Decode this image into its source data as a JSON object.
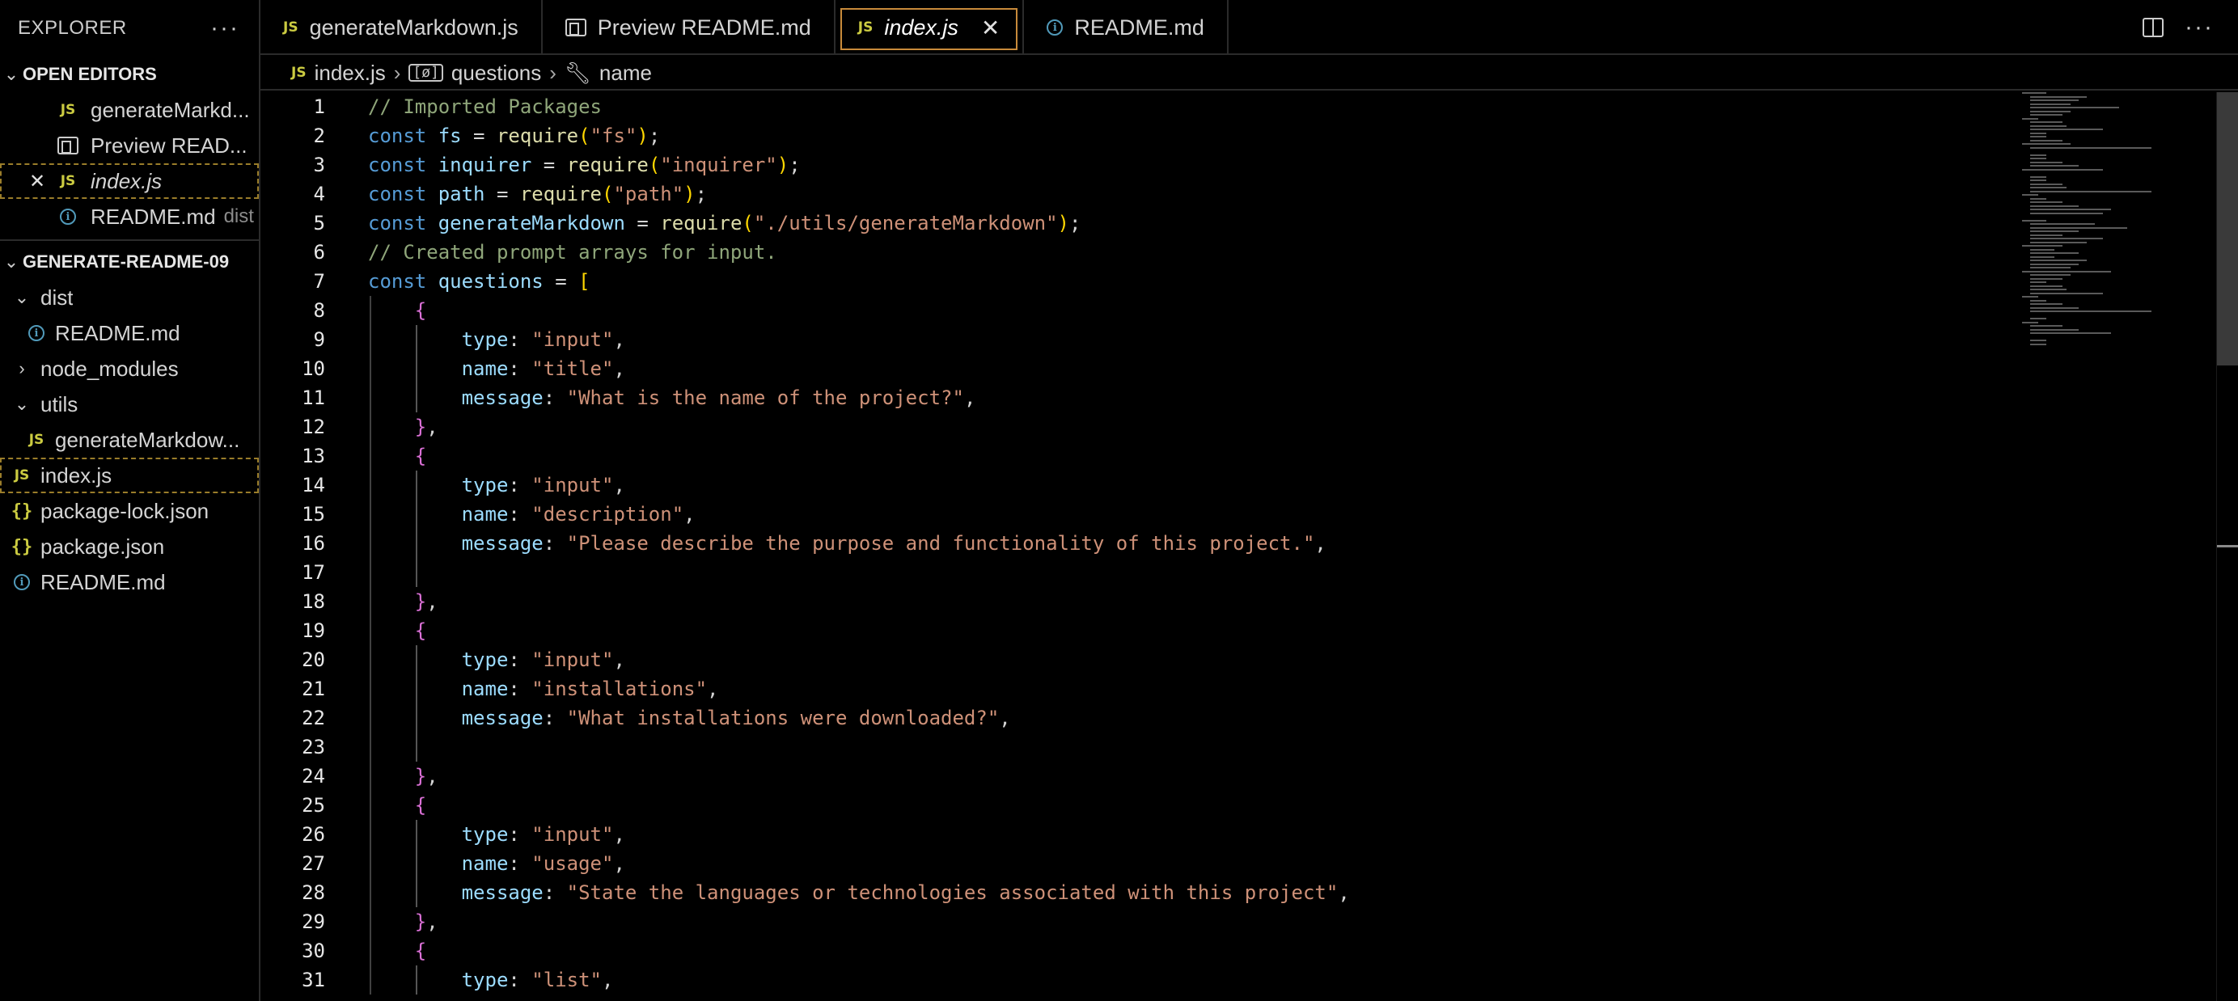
{
  "explorer": {
    "title": "EXPLORER",
    "more_label": "···",
    "open_editors_label": "OPEN EDITORS",
    "open_editors": [
      {
        "label": "generateMarkd...",
        "icon": "js-icon",
        "desc": ""
      },
      {
        "label": "Preview READ...",
        "icon": "preview-icon",
        "desc": ""
      },
      {
        "label": "index.js",
        "icon": "js-icon",
        "desc": "",
        "active": true
      },
      {
        "label": "README.md",
        "icon": "info-icon",
        "desc": "dist"
      }
    ],
    "project_label": "GENERATE-README-09",
    "tree": [
      {
        "label": "dist",
        "type": "folder-open"
      },
      {
        "label": "README.md",
        "type": "info"
      },
      {
        "label": "node_modules",
        "type": "folder-closed"
      },
      {
        "label": "utils",
        "type": "folder-open"
      },
      {
        "label": "generateMarkdow...",
        "type": "js"
      },
      {
        "label": "index.js",
        "type": "js"
      },
      {
        "label": "package-lock.json",
        "type": "json"
      },
      {
        "label": "package.json",
        "type": "json"
      },
      {
        "label": "README.md",
        "type": "info"
      }
    ]
  },
  "tabs": [
    {
      "label": "generateMarkdown.js",
      "icon": "js-icon"
    },
    {
      "label": "Preview README.md",
      "icon": "preview-icon"
    },
    {
      "label": "index.js",
      "icon": "js-icon",
      "active": true,
      "close": "✕"
    },
    {
      "label": "README.md",
      "icon": "info-icon"
    }
  ],
  "tab_actions": {
    "split": "split-editor-icon",
    "more": "···"
  },
  "breadcrumb": [
    "index.js",
    "questions",
    "name"
  ],
  "code": {
    "lines": [
      [
        [
          "// Imported Packages",
          "com"
        ]
      ],
      [
        [
          "const ",
          "kw"
        ],
        [
          "fs",
          "var"
        ],
        [
          " = ",
          "punc"
        ],
        [
          "require",
          "fn"
        ],
        [
          "(",
          "br1"
        ],
        [
          "\"fs\"",
          "str"
        ],
        [
          ")",
          "br1"
        ],
        [
          ";",
          "punc"
        ]
      ],
      [
        [
          "const ",
          "kw"
        ],
        [
          "inquirer",
          "var"
        ],
        [
          " = ",
          "punc"
        ],
        [
          "require",
          "fn"
        ],
        [
          "(",
          "br1"
        ],
        [
          "\"inquirer\"",
          "str"
        ],
        [
          ")",
          "br1"
        ],
        [
          ";",
          "punc"
        ]
      ],
      [
        [
          "const ",
          "kw"
        ],
        [
          "path",
          "var"
        ],
        [
          " = ",
          "punc"
        ],
        [
          "require",
          "fn"
        ],
        [
          "(",
          "br1"
        ],
        [
          "\"path\"",
          "str"
        ],
        [
          ")",
          "br1"
        ],
        [
          ";",
          "punc"
        ]
      ],
      [
        [
          "const ",
          "kw"
        ],
        [
          "generateMarkdown",
          "var"
        ],
        [
          " = ",
          "punc"
        ],
        [
          "require",
          "fn"
        ],
        [
          "(",
          "br1"
        ],
        [
          "\"./utils/generateMarkdown\"",
          "str"
        ],
        [
          ")",
          "br1"
        ],
        [
          ";",
          "punc"
        ]
      ],
      [
        [
          "// Created prompt arrays for input.",
          "com"
        ]
      ],
      [
        [
          "const ",
          "kw"
        ],
        [
          "questions",
          "var"
        ],
        [
          " = ",
          "punc"
        ],
        [
          "[",
          "br1"
        ]
      ],
      [
        [
          "    ",
          "punc"
        ],
        [
          "{",
          "br2"
        ]
      ],
      [
        [
          "        ",
          "punc"
        ],
        [
          "type",
          "var"
        ],
        [
          ": ",
          "punc"
        ],
        [
          "\"input\"",
          "str"
        ],
        [
          ",",
          "punc"
        ]
      ],
      [
        [
          "        ",
          "punc"
        ],
        [
          "name",
          "var"
        ],
        [
          ": ",
          "punc"
        ],
        [
          "\"title\"",
          "str"
        ],
        [
          ",",
          "punc"
        ]
      ],
      [
        [
          "        ",
          "punc"
        ],
        [
          "message",
          "var"
        ],
        [
          ": ",
          "punc"
        ],
        [
          "\"What is the name of the project?\"",
          "str"
        ],
        [
          ",",
          "punc"
        ]
      ],
      [
        [
          "    ",
          "punc"
        ],
        [
          "}",
          "br2"
        ],
        [
          ",",
          "punc"
        ]
      ],
      [
        [
          "    ",
          "punc"
        ],
        [
          "{",
          "br2"
        ]
      ],
      [
        [
          "        ",
          "punc"
        ],
        [
          "type",
          "var"
        ],
        [
          ": ",
          "punc"
        ],
        [
          "\"input\"",
          "str"
        ],
        [
          ",",
          "punc"
        ]
      ],
      [
        [
          "        ",
          "punc"
        ],
        [
          "name",
          "var"
        ],
        [
          ": ",
          "punc"
        ],
        [
          "\"description\"",
          "str"
        ],
        [
          ",",
          "punc"
        ]
      ],
      [
        [
          "        ",
          "punc"
        ],
        [
          "message",
          "var"
        ],
        [
          ": ",
          "punc"
        ],
        [
          "\"Please describe the purpose and functionality of this project.\"",
          "str"
        ],
        [
          ",",
          "punc"
        ]
      ],
      [],
      [
        [
          "    ",
          "punc"
        ],
        [
          "}",
          "br2"
        ],
        [
          ",",
          "punc"
        ]
      ],
      [
        [
          "    ",
          "punc"
        ],
        [
          "{",
          "br2"
        ]
      ],
      [
        [
          "        ",
          "punc"
        ],
        [
          "type",
          "var"
        ],
        [
          ": ",
          "punc"
        ],
        [
          "\"input\"",
          "str"
        ],
        [
          ",",
          "punc"
        ]
      ],
      [
        [
          "        ",
          "punc"
        ],
        [
          "name",
          "var"
        ],
        [
          ": ",
          "punc"
        ],
        [
          "\"installations\"",
          "str"
        ],
        [
          ",",
          "punc"
        ]
      ],
      [
        [
          "        ",
          "punc"
        ],
        [
          "message",
          "var"
        ],
        [
          ": ",
          "punc"
        ],
        [
          "\"What installations were downloaded?\"",
          "str"
        ],
        [
          ",",
          "punc"
        ]
      ],
      [],
      [
        [
          "    ",
          "punc"
        ],
        [
          "}",
          "br2"
        ],
        [
          ",",
          "punc"
        ]
      ],
      [
        [
          "    ",
          "punc"
        ],
        [
          "{",
          "br2"
        ]
      ],
      [
        [
          "        ",
          "punc"
        ],
        [
          "type",
          "var"
        ],
        [
          ": ",
          "punc"
        ],
        [
          "\"input\"",
          "str"
        ],
        [
          ",",
          "punc"
        ]
      ],
      [
        [
          "        ",
          "punc"
        ],
        [
          "name",
          "var"
        ],
        [
          ": ",
          "punc"
        ],
        [
          "\"usage\"",
          "str"
        ],
        [
          ",",
          "punc"
        ]
      ],
      [
        [
          "        ",
          "punc"
        ],
        [
          "message",
          "var"
        ],
        [
          ": ",
          "punc"
        ],
        [
          "\"State the languages or technologies associated with this project\"",
          "str"
        ],
        [
          ",",
          "punc"
        ]
      ],
      [
        [
          "    ",
          "punc"
        ],
        [
          "}",
          "br2"
        ],
        [
          ",",
          "punc"
        ]
      ],
      [
        [
          "    ",
          "punc"
        ],
        [
          "{",
          "br2"
        ]
      ],
      [
        [
          "        ",
          "punc"
        ],
        [
          "type",
          "var"
        ],
        [
          ": ",
          "punc"
        ],
        [
          "\"list\"",
          "str"
        ],
        [
          ",",
          "punc"
        ]
      ]
    ]
  },
  "colors": {
    "comment": "#8fa67a",
    "keyword": "#569cd6",
    "variable": "#9cdcfe",
    "string": "#ce9178",
    "function": "#dcdcaa",
    "bracket1": "#ffd700",
    "bracket2": "#da70d6",
    "active_tab_border": "#c88a3a"
  }
}
